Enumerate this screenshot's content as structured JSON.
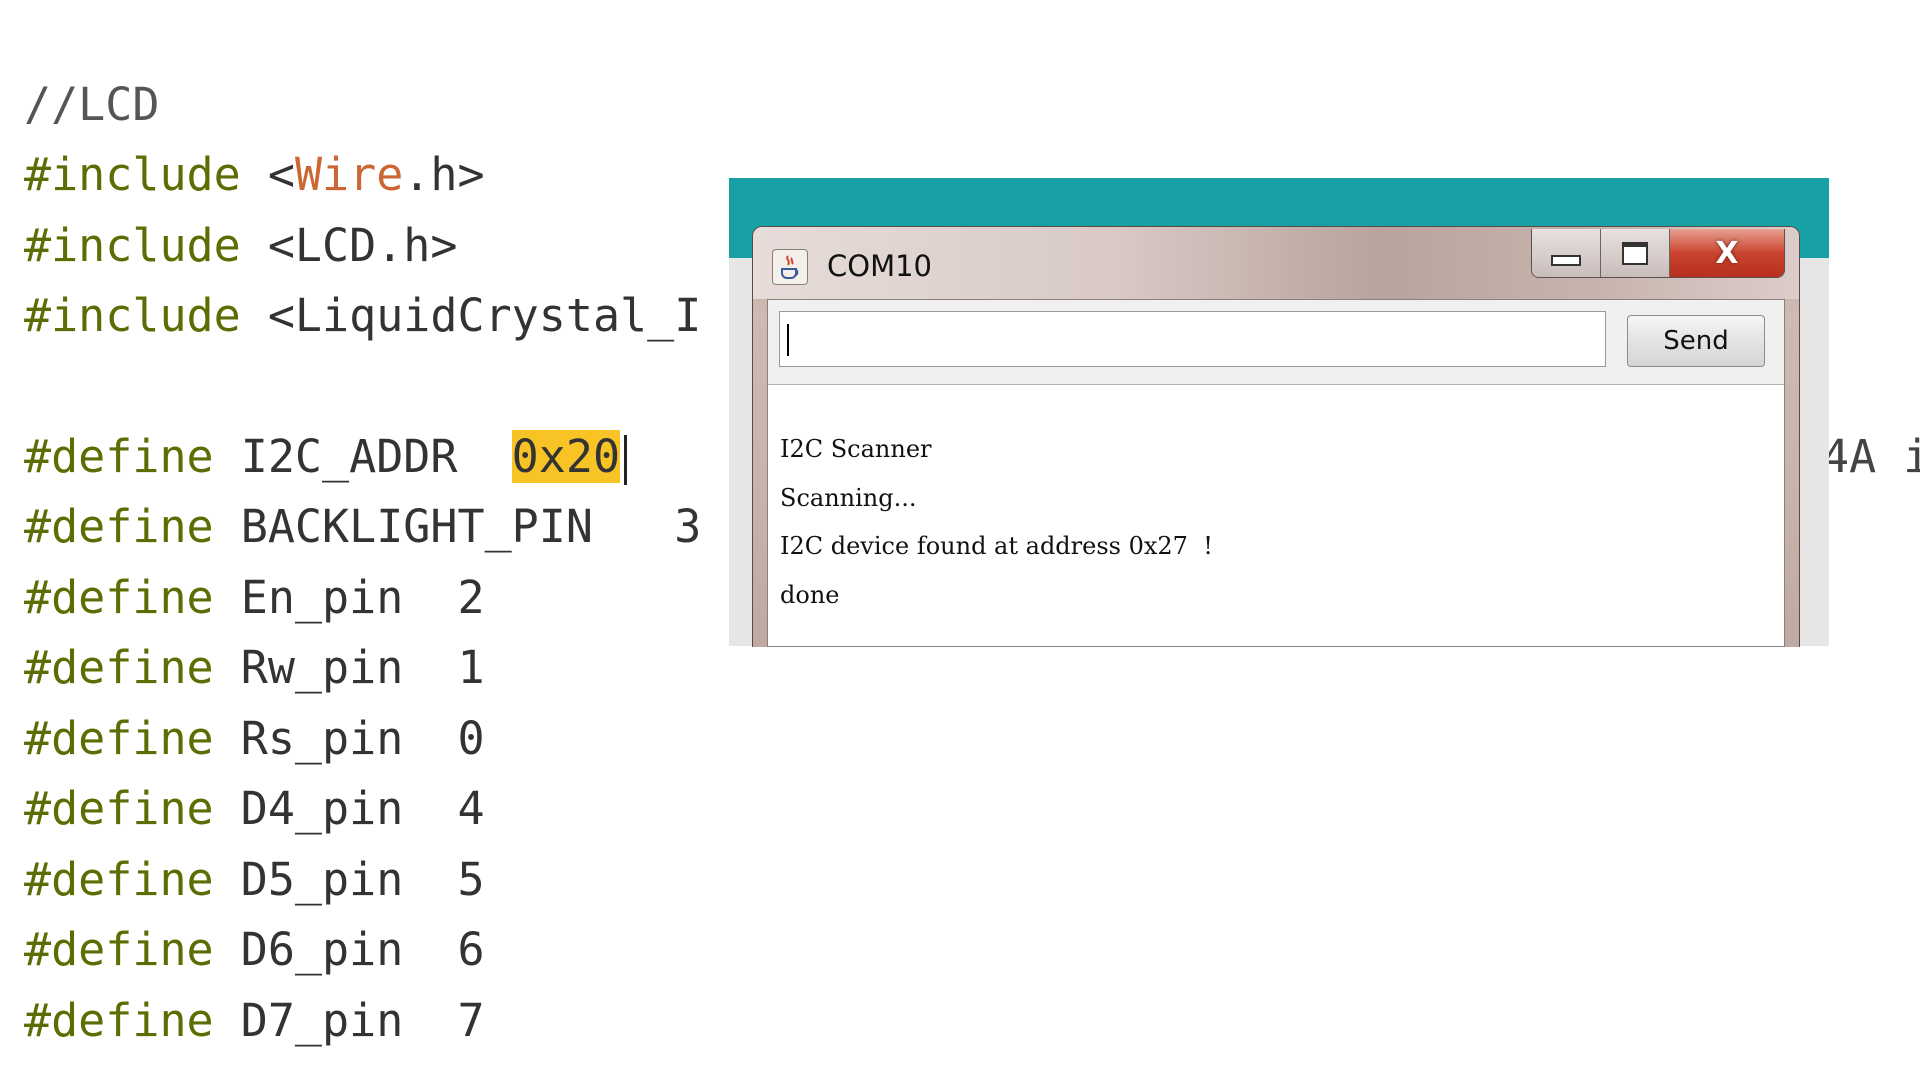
{
  "editor": {
    "lines": [
      {
        "id": "l1",
        "parts": [
          {
            "t": "//LCD",
            "c": "comment"
          }
        ]
      },
      {
        "id": "l2",
        "parts": [
          {
            "t": "#include",
            "c": "directive"
          },
          {
            "t": " <",
            "c": "plain"
          },
          {
            "t": "Wire",
            "c": "lib"
          },
          {
            "t": ".h>",
            "c": "plain"
          }
        ]
      },
      {
        "id": "l3",
        "parts": [
          {
            "t": "#include",
            "c": "directive"
          },
          {
            "t": " <LCD.h>",
            "c": "plain"
          }
        ]
      },
      {
        "id": "l4",
        "parts": [
          {
            "t": "#include",
            "c": "directive"
          },
          {
            "t": " <LiquidCrystal_I",
            "c": "plain"
          }
        ]
      },
      {
        "id": "l5",
        "parts": []
      },
      {
        "id": "l6",
        "parts": [
          {
            "t": "#define",
            "c": "directive"
          },
          {
            "t": " I2C_ADDR  ",
            "c": "plain"
          },
          {
            "t": "0x20",
            "c": "hl"
          }
        ]
      },
      {
        "id": "l7",
        "parts": [
          {
            "t": "#define",
            "c": "directive"
          },
          {
            "t": " BACKLIGHT_PIN   3",
            "c": "plain"
          }
        ]
      },
      {
        "id": "l8",
        "parts": [
          {
            "t": "#define",
            "c": "directive"
          },
          {
            "t": " En_pin  2",
            "c": "plain"
          }
        ]
      },
      {
        "id": "l9",
        "parts": [
          {
            "t": "#define",
            "c": "directive"
          },
          {
            "t": " Rw_pin  1",
            "c": "plain"
          }
        ]
      },
      {
        "id": "l10",
        "parts": [
          {
            "t": "#define",
            "c": "directive"
          },
          {
            "t": " Rs_pin  0",
            "c": "plain"
          }
        ]
      },
      {
        "id": "l11",
        "parts": [
          {
            "t": "#define",
            "c": "directive"
          },
          {
            "t": " D4_pin  4",
            "c": "plain"
          }
        ]
      },
      {
        "id": "l12",
        "parts": [
          {
            "t": "#define",
            "c": "directive"
          },
          {
            "t": " D5_pin  5",
            "c": "plain"
          }
        ]
      },
      {
        "id": "l13",
        "parts": [
          {
            "t": "#define",
            "c": "directive"
          },
          {
            "t": " D6_pin  6",
            "c": "plain"
          }
        ]
      },
      {
        "id": "l14",
        "parts": [
          {
            "t": "#define",
            "c": "directive"
          },
          {
            "t": " D7_pin  7",
            "c": "plain"
          }
        ]
      }
    ],
    "right_fragment": "4A i"
  },
  "serial_monitor": {
    "title": "COM10",
    "icon": "java-cup-icon",
    "input_value": "",
    "send_label": "Send",
    "close_glyph": "X",
    "output_lines": [
      "",
      "I2C Scanner",
      "Scanning...",
      "I2C device found at address 0x27  !",
      "done"
    ]
  },
  "colors": {
    "directive": "#5e6d03",
    "library": "#cc6633",
    "highlight": "#f7c325",
    "ide_teal": "#17a1a5",
    "close_red": "#c9432f"
  }
}
